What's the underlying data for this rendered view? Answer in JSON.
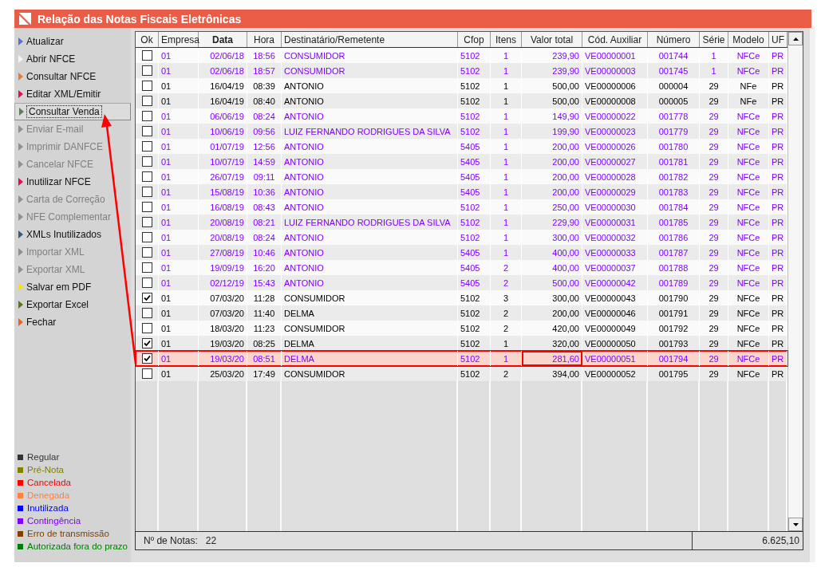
{
  "window": {
    "title": "Relação das Notas Fiscais Eletrônicas"
  },
  "sidebar": {
    "items": [
      {
        "label": "Atualizar",
        "color": "#5b6fe0",
        "disabled": false,
        "focused": false
      },
      {
        "label": "Abrir NFCE",
        "color": "#f4f4f4",
        "disabled": false,
        "focused": false
      },
      {
        "label": "Consultar NFCE",
        "color": "#e57a3a",
        "disabled": false,
        "focused": false
      },
      {
        "label": "Editar XML/Emitir",
        "color": "#e0104e",
        "disabled": false,
        "focused": false
      },
      {
        "label": "Consultar Venda",
        "color": "#5f7f5f",
        "disabled": false,
        "focused": true
      },
      {
        "label": "Enviar E-mail",
        "color": "#909090",
        "disabled": true,
        "focused": false
      },
      {
        "label": "Imprimir DANFCE",
        "color": "#909090",
        "disabled": true,
        "focused": false
      },
      {
        "label": "Cancelar NFCE",
        "color": "#909090",
        "disabled": true,
        "focused": false
      },
      {
        "label": "Inutilizar NFCE",
        "color": "#e0104e",
        "disabled": false,
        "focused": false
      },
      {
        "label": "Carta de Correção",
        "color": "#909090",
        "disabled": true,
        "focused": false
      },
      {
        "label": "NFE Complementar",
        "color": "#909090",
        "disabled": true,
        "focused": false
      },
      {
        "label": "XMLs Inutilizados",
        "color": "#3a5a80",
        "disabled": false,
        "focused": false
      },
      {
        "label": "Importar XML",
        "color": "#909090",
        "disabled": true,
        "focused": false
      },
      {
        "label": "Exportar XML",
        "color": "#909090",
        "disabled": true,
        "focused": false
      },
      {
        "label": "Salvar em PDF",
        "color": "#f4e400",
        "disabled": false,
        "focused": false
      },
      {
        "label": "Exportar Excel",
        "color": "#5a7a10",
        "disabled": false,
        "focused": false
      },
      {
        "label": "Fechar",
        "color": "#f06020",
        "disabled": false,
        "focused": false
      }
    ]
  },
  "legend": [
    {
      "label": "Regular",
      "color": "#333333"
    },
    {
      "label": "Pré-Nota",
      "color": "#808000"
    },
    {
      "label": "Cancelada",
      "color": "#ff0000"
    },
    {
      "label": "Denegada",
      "color": "#ff8040"
    },
    {
      "label": "Inutilizada",
      "color": "#0000ff"
    },
    {
      "label": "Contingência",
      "color": "#8000ff"
    },
    {
      "label": "Erro de transmissão",
      "color": "#804000"
    },
    {
      "label": "Autorizada fora do prazo",
      "color": "#008000"
    }
  ],
  "table": {
    "columns": [
      {
        "label": "Ok",
        "sorted": false
      },
      {
        "label": "Empresa",
        "sorted": false
      },
      {
        "label": "Data",
        "sorted": true
      },
      {
        "label": "Hora",
        "sorted": false
      },
      {
        "label": "Destinatário/Remetente",
        "sorted": false
      },
      {
        "label": "Cfop",
        "sorted": false
      },
      {
        "label": "Itens",
        "sorted": false
      },
      {
        "label": "Valor total",
        "sorted": false
      },
      {
        "label": "Cód. Auxiliar",
        "sorted": false
      },
      {
        "label": "Número",
        "sorted": false
      },
      {
        "label": "Série",
        "sorted": false
      },
      {
        "label": "Modelo",
        "sorted": false
      },
      {
        "label": "UF",
        "sorted": false
      }
    ],
    "rows": [
      {
        "checked": false,
        "highlighted": false,
        "color": "#8000ff",
        "cells": [
          "",
          "01",
          "02/06/18",
          "18:56",
          "CONSUMIDOR",
          "5102",
          "1",
          "239,90",
          "VE00000001",
          "001744",
          "1",
          "NFCe",
          "PR"
        ]
      },
      {
        "checked": false,
        "highlighted": false,
        "color": "#8000ff",
        "cells": [
          "",
          "01",
          "02/06/18",
          "18:57",
          "CONSUMIDOR",
          "5102",
          "1",
          "239,90",
          "VE00000003",
          "001745",
          "1",
          "NFCe",
          "PR"
        ]
      },
      {
        "checked": false,
        "highlighted": false,
        "color": "#000000",
        "cells": [
          "",
          "01",
          "16/04/19",
          "08:39",
          "ANTONIO",
          "5102",
          "1",
          "500,00",
          "VE00000006",
          "000004",
          "29",
          "NFe",
          "PR"
        ]
      },
      {
        "checked": false,
        "highlighted": false,
        "color": "#000000",
        "cells": [
          "",
          "01",
          "16/04/19",
          "08:40",
          "ANTONIO",
          "5102",
          "1",
          "500,00",
          "VE00000008",
          "000005",
          "29",
          "NFe",
          "PR"
        ]
      },
      {
        "checked": false,
        "highlighted": false,
        "color": "#8000ff",
        "cells": [
          "",
          "01",
          "06/06/19",
          "08:24",
          "ANTONIO",
          "5102",
          "1",
          "149,90",
          "VE00000022",
          "001778",
          "29",
          "NFCe",
          "PR"
        ]
      },
      {
        "checked": false,
        "highlighted": false,
        "color": "#8000ff",
        "cells": [
          "",
          "01",
          "10/06/19",
          "09:56",
          "LUIZ FERNANDO RODRIGUES DA SILVA",
          "5102",
          "1",
          "199,90",
          "VE00000023",
          "001779",
          "29",
          "NFCe",
          "PR"
        ]
      },
      {
        "checked": false,
        "highlighted": false,
        "color": "#8000ff",
        "cells": [
          "",
          "01",
          "01/07/19",
          "12:56",
          "ANTONIO",
          "5405",
          "1",
          "200,00",
          "VE00000026",
          "001780",
          "29",
          "NFCe",
          "PR"
        ]
      },
      {
        "checked": false,
        "highlighted": false,
        "color": "#8000ff",
        "cells": [
          "",
          "01",
          "10/07/19",
          "14:59",
          "ANTONIO",
          "5405",
          "1",
          "200,00",
          "VE00000027",
          "001781",
          "29",
          "NFCe",
          "PR"
        ]
      },
      {
        "checked": false,
        "highlighted": false,
        "color": "#8000ff",
        "cells": [
          "",
          "01",
          "26/07/19",
          "09:11",
          "ANTONIO",
          "5405",
          "1",
          "200,00",
          "VE00000028",
          "001782",
          "29",
          "NFCe",
          "PR"
        ]
      },
      {
        "checked": false,
        "highlighted": false,
        "color": "#8000ff",
        "cells": [
          "",
          "01",
          "15/08/19",
          "10:36",
          "ANTONIO",
          "5405",
          "1",
          "200,00",
          "VE00000029",
          "001783",
          "29",
          "NFCe",
          "PR"
        ]
      },
      {
        "checked": false,
        "highlighted": false,
        "color": "#8000ff",
        "cells": [
          "",
          "01",
          "16/08/19",
          "08:43",
          "ANTONIO",
          "5102",
          "1",
          "250,00",
          "VE00000030",
          "001784",
          "29",
          "NFCe",
          "PR"
        ]
      },
      {
        "checked": false,
        "highlighted": false,
        "color": "#8000ff",
        "cells": [
          "",
          "01",
          "20/08/19",
          "08:21",
          "LUIZ FERNANDO RODRIGUES DA SILVA",
          "5102",
          "1",
          "229,90",
          "VE00000031",
          "001785",
          "29",
          "NFCe",
          "PR"
        ]
      },
      {
        "checked": false,
        "highlighted": false,
        "color": "#8000ff",
        "cells": [
          "",
          "01",
          "20/08/19",
          "08:24",
          "ANTONIO",
          "5102",
          "1",
          "300,00",
          "VE00000032",
          "001786",
          "29",
          "NFCe",
          "PR"
        ]
      },
      {
        "checked": false,
        "highlighted": false,
        "color": "#8000ff",
        "cells": [
          "",
          "01",
          "27/08/19",
          "10:46",
          "ANTONIO",
          "5405",
          "1",
          "400,00",
          "VE00000033",
          "001787",
          "29",
          "NFCe",
          "PR"
        ]
      },
      {
        "checked": false,
        "highlighted": false,
        "color": "#8000ff",
        "cells": [
          "",
          "01",
          "19/09/19",
          "16:20",
          "ANTONIO",
          "5405",
          "2",
          "400,00",
          "VE00000037",
          "001788",
          "29",
          "NFCe",
          "PR"
        ]
      },
      {
        "checked": false,
        "highlighted": false,
        "color": "#8000ff",
        "cells": [
          "",
          "01",
          "02/12/19",
          "15:43",
          "ANTONIO",
          "5405",
          "2",
          "500,00",
          "VE00000042",
          "001789",
          "29",
          "NFCe",
          "PR"
        ]
      },
      {
        "checked": true,
        "highlighted": false,
        "color": "#000000",
        "cells": [
          "",
          "01",
          "07/03/20",
          "11:28",
          "CONSUMIDOR",
          "5102",
          "3",
          "300,00",
          "VE00000043",
          "001790",
          "29",
          "NFCe",
          "PR"
        ]
      },
      {
        "checked": false,
        "highlighted": false,
        "color": "#000000",
        "cells": [
          "",
          "01",
          "07/03/20",
          "11:40",
          "DELMA",
          "5102",
          "2",
          "200,00",
          "VE00000046",
          "001791",
          "29",
          "NFCe",
          "PR"
        ]
      },
      {
        "checked": false,
        "highlighted": false,
        "color": "#000000",
        "cells": [
          "",
          "01",
          "18/03/20",
          "11:23",
          "CONSUMIDOR",
          "5102",
          "2",
          "420,00",
          "VE00000049",
          "001792",
          "29",
          "NFCe",
          "PR"
        ]
      },
      {
        "checked": true,
        "highlighted": false,
        "color": "#000000",
        "cells": [
          "",
          "01",
          "19/03/20",
          "08:25",
          "DELMA",
          "5102",
          "1",
          "320,00",
          "VE00000050",
          "001793",
          "29",
          "NFCe",
          "PR"
        ]
      },
      {
        "checked": true,
        "highlighted": true,
        "color": "#8000ff",
        "cells": [
          "",
          "01",
          "19/03/20",
          "08:51",
          "DELMA",
          "5102",
          "1",
          "281,60",
          "VE00000051",
          "001794",
          "29",
          "NFCe",
          "PR"
        ]
      },
      {
        "checked": false,
        "highlighted": false,
        "color": "#000000",
        "cells": [
          "",
          "01",
          "25/03/20",
          "17:49",
          "CONSUMIDOR",
          "5102",
          "2",
          "394,00",
          "VE00000052",
          "001795",
          "29",
          "NFCe",
          "PR"
        ]
      }
    ]
  },
  "status_bar": {
    "label": "Nº de Notas:",
    "count": "22",
    "total": "6.625,10"
  }
}
